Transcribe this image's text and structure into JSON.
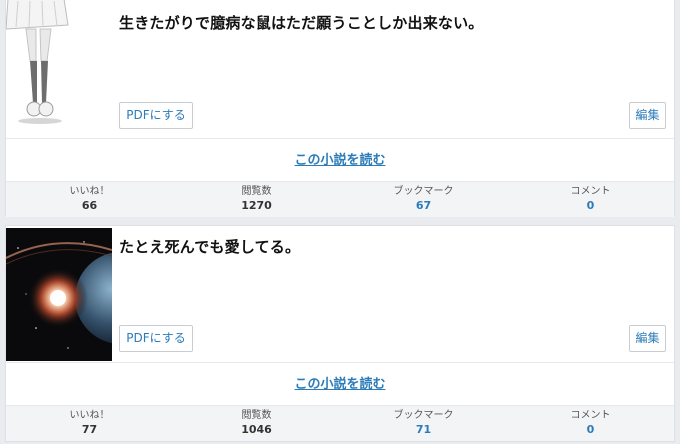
{
  "novels": [
    {
      "title": "生きたがりで臆病な鼠はただ願うことしか出来ない。",
      "thumbnail_icon": "girl-legs-illustration",
      "pdf_label": "PDFにする",
      "edit_label": "編集",
      "read_label": "この小説を読む",
      "stats": {
        "likes_label": "いいね！",
        "likes": "66",
        "views_label": "閲覧数",
        "views": "1270",
        "bookmarks_label": "ブックマーク",
        "bookmarks": "67",
        "comments_label": "コメント",
        "comments": "0"
      }
    },
    {
      "title": "たとえ死んでも愛してる。",
      "thumbnail_icon": "space-planet-illustration",
      "pdf_label": "PDFにする",
      "edit_label": "編集",
      "read_label": "この小説を読む",
      "stats": {
        "likes_label": "いいね！",
        "likes": "77",
        "views_label": "閲覧数",
        "views": "1046",
        "bookmarks_label": "ブックマーク",
        "bookmarks": "71",
        "comments_label": "コメント",
        "comments": "0"
      }
    }
  ],
  "colors": {
    "link": "#2b7bb9",
    "page_background": "#e9ebee",
    "stats_background": "#f3f4f6"
  }
}
